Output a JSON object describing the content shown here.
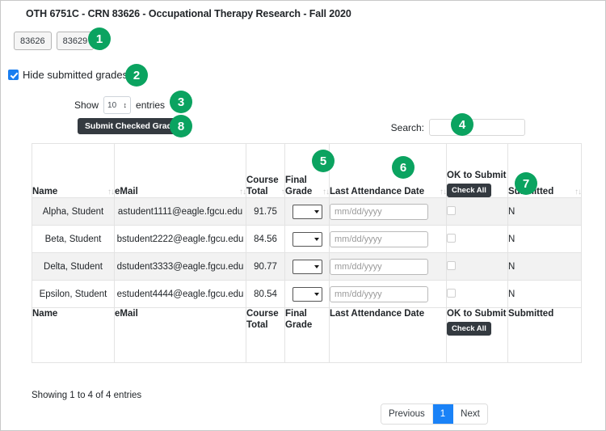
{
  "header": {
    "course_title": "OTH 6751C - CRN 83626 - Occupational Therapy Research - Fall 2020"
  },
  "crn_buttons": [
    {
      "label": "83626"
    },
    {
      "label": "83629"
    }
  ],
  "hide_submitted": {
    "label": "Hide submitted grades",
    "checked": true
  },
  "length_menu": {
    "prefix": "Show",
    "value": "10",
    "suffix": "entries"
  },
  "submit_button": {
    "label": "Submit Checked Grades"
  },
  "search": {
    "label": "Search:",
    "value": "",
    "placeholder": ""
  },
  "table": {
    "columns": [
      {
        "key": "name",
        "label": "Name",
        "sortable": true
      },
      {
        "key": "email",
        "label": "eMail",
        "sortable": true
      },
      {
        "key": "course_total",
        "label": "Course Total",
        "sortable": true
      },
      {
        "key": "final_grade",
        "label": "Final Grade",
        "sortable": true
      },
      {
        "key": "last_attendance",
        "label": "Last Attendance Date",
        "sortable": true
      },
      {
        "key": "ok_to_submit",
        "label": "OK to Submit",
        "sortable": false,
        "button": "Check All"
      },
      {
        "key": "submitted",
        "label": "Submitted",
        "sortable": true
      }
    ],
    "sort_icon": "↑↓",
    "rows": [
      {
        "name": "Alpha, Student",
        "email": "astudent1111@eagle.fgcu.edu",
        "course_total": "91.75",
        "final_grade": "",
        "last_attendance": "",
        "date_placeholder": "mm/dd/yyyy",
        "ok_to_submit": false,
        "submitted": "N"
      },
      {
        "name": "Beta, Student",
        "email": "bstudent2222@eagle.fgcu.edu",
        "course_total": "84.56",
        "final_grade": "",
        "last_attendance": "",
        "date_placeholder": "mm/dd/yyyy",
        "ok_to_submit": false,
        "submitted": "N"
      },
      {
        "name": "Delta, Student",
        "email": "dstudent3333@eagle.fgcu.edu",
        "course_total": "90.77",
        "final_grade": "",
        "last_attendance": "",
        "date_placeholder": "mm/dd/yyyy",
        "ok_to_submit": false,
        "submitted": "N"
      },
      {
        "name": "Epsilon, Student",
        "email": "estudent4444@eagle.fgcu.edu",
        "course_total": "80.54",
        "final_grade": "",
        "last_attendance": "",
        "date_placeholder": "mm/dd/yyyy",
        "ok_to_submit": false,
        "submitted": "N"
      }
    ],
    "footer": {
      "name": "Name",
      "email": "eMail",
      "course_total": "Course Total",
      "final_grade": "Final Grade",
      "last_attendance": "Last Attendance Date",
      "ok_to_submit": "OK to Submit",
      "check_all": "Check All",
      "submitted": "Submitted"
    }
  },
  "info": {
    "text": "Showing 1 to 4 of 4 entries"
  },
  "pagination": {
    "previous": "Previous",
    "pages": [
      "1"
    ],
    "next": "Next",
    "active": "1"
  },
  "callouts": [
    {
      "n": "1"
    },
    {
      "n": "2"
    },
    {
      "n": "3"
    },
    {
      "n": "4"
    },
    {
      "n": "5"
    },
    {
      "n": "6"
    },
    {
      "n": "7"
    },
    {
      "n": "8"
    }
  ],
  "colors": {
    "callout_green": "#0ba360",
    "active_page_blue": "#1a82f7",
    "checkbox_blue": "#1a7ef0",
    "dark_button": "#343a40",
    "stripe": "#f2f2f2"
  }
}
